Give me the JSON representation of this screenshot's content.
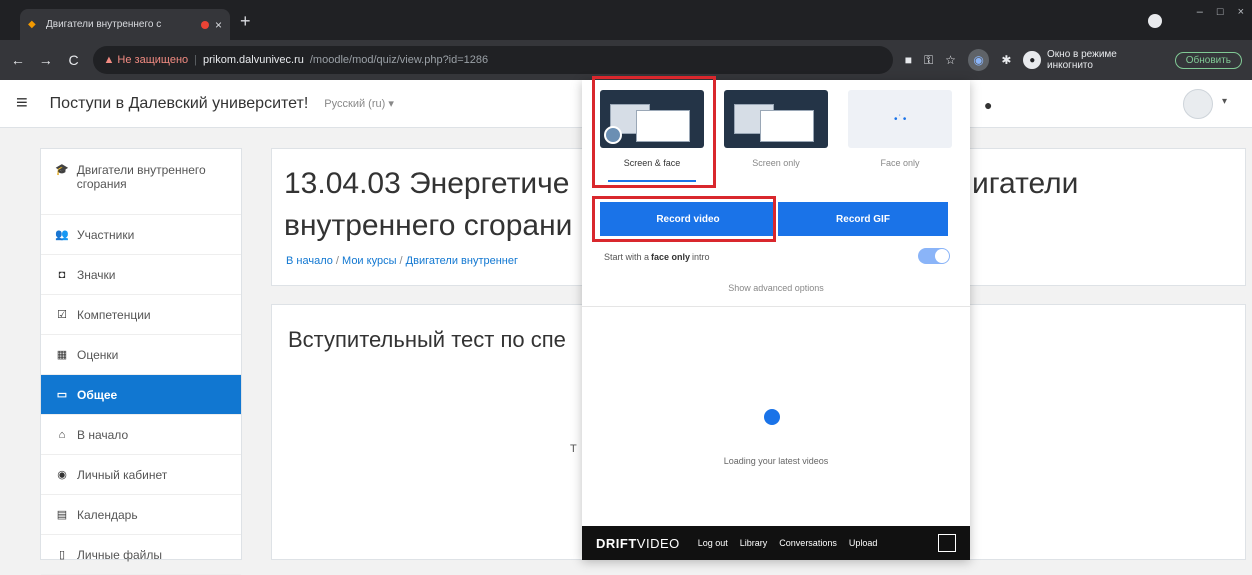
{
  "browser": {
    "tab_title": "Двигатели внутреннего с",
    "tab_close": "×",
    "new_tab": "+",
    "window_controls": [
      "–",
      "□",
      "×"
    ],
    "back": "←",
    "forward": "→",
    "reload": "C",
    "security_warning": "▲ Не защищено",
    "url_host": "prikom.dalvunivec.ru",
    "url_path": "/moodle/mod/quiz/view.php?id=1286",
    "incognito_label": "Окно в режиме инкогнито",
    "update_button": "Обновить"
  },
  "navbar": {
    "menu_icon": "≡",
    "site_name": "Поступи в Далевский университет!",
    "language": "Русский (ru) ▾",
    "avatar_caret": "▾"
  },
  "sidebar": {
    "items": [
      {
        "icon": "🎓",
        "label": "Двигатели внутреннего сгорания"
      },
      {
        "icon": "👥",
        "label": "Участники"
      },
      {
        "icon": "◘",
        "label": "Значки"
      },
      {
        "icon": "☑",
        "label": "Компетенции"
      },
      {
        "icon": "▦",
        "label": "Оценки"
      },
      {
        "icon": "▭",
        "label": "Общее"
      },
      {
        "icon": "⌂",
        "label": "В начало"
      },
      {
        "icon": "◉",
        "label": "Личный кабинет"
      },
      {
        "icon": "▤",
        "label": "Календарь"
      },
      {
        "icon": "▯",
        "label": "Личные файлы"
      }
    ]
  },
  "course": {
    "title_line1": "13.04.03 Энергетиче",
    "title_line2": "внутреннего сгорани",
    "title_right": "игатели",
    "breadcrumb_home": "В начало",
    "breadcrumb_sep": " / ",
    "breadcrumb_courses": "Мои курсы",
    "breadcrumb_course": "Двигатели внутреннег"
  },
  "quiz": {
    "title": "Вступительный тест по спе",
    "fragment": "Т"
  },
  "drift": {
    "modes": [
      {
        "label": "Screen & face",
        "selected": true
      },
      {
        "label": "Screen only",
        "selected": false
      },
      {
        "label": "Face only",
        "selected": false
      }
    ],
    "record_video": "Record video",
    "record_gif": "Record GIF",
    "face_intro_prefix": "Start with a",
    "face_intro_bold": "face only",
    "face_intro_suffix": "intro",
    "face_intro_enabled": true,
    "advanced_options": "Show advanced options",
    "loading_text": "Loading your latest videos",
    "brand_bold": "DRIFT",
    "brand_light": "VIDEO",
    "footer_links": [
      "Log out",
      "Library",
      "Conversations",
      "Upload"
    ]
  },
  "colors": {
    "accent": "#1a73e8",
    "active_sidebar": "#1177d1",
    "highlight": "#d9272d"
  }
}
